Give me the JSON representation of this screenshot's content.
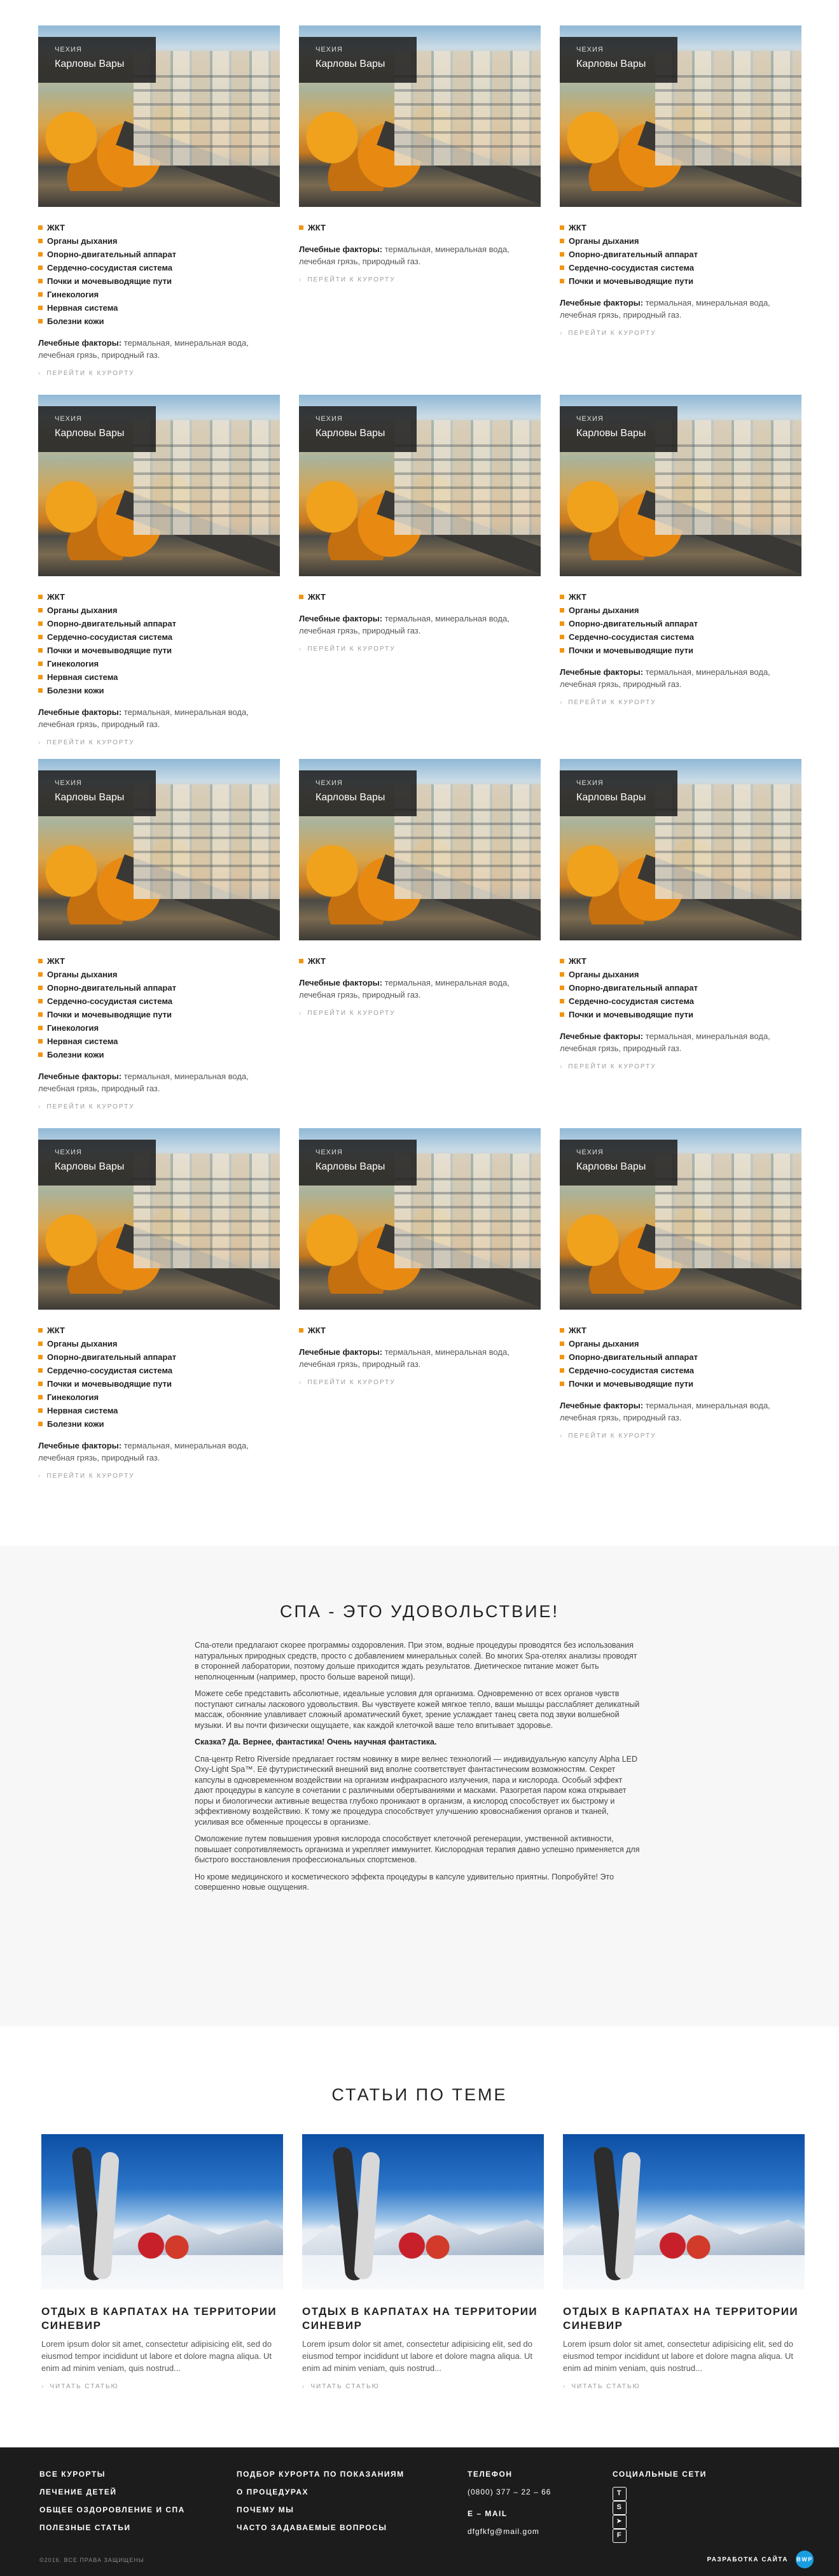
{
  "resort": {
    "country": "ЧЕХИЯ",
    "city": "Карловы Вары",
    "factors_label": "Лечебные факторы:",
    "factors_text": " термальная, минеральная вода, лечебная грязь, природный газ.",
    "go_label": "ПЕРЕЙТИ К КУРОРТУ"
  },
  "list_full": [
    "ЖКТ",
    "Органы дыхания",
    "Опорно-двигательный аппарат",
    "Сердечно-сосудистая система",
    "Почки и мочевыводящие пути",
    "Гинекология",
    "Нервная система",
    "Болезни кожи"
  ],
  "list_one": [
    "ЖКТ"
  ],
  "list_five": [
    "ЖКТ",
    "Органы дыхания",
    "Опорно-двигательный аппарат",
    "Сердечно-сосудистая система",
    "Почки и мочевыводящие пути"
  ],
  "spa": {
    "title": "СПА - ЭТО УДОВОЛЬСТВИЕ!",
    "p1": "Спа-отели предлагают скорее программы оздоровления. При этом, водные процедуры проводятся без использования натуральных природных средств, просто с добавлением минеральных солей. Во многих Spa-отелях анализы проводят в сторонней лаборатории, поэтому дольше приходится ждать результатов. Диетическое питание может быть неполноценным (например, просто больше вареной пищи).",
    "p2": "Можете себе представить абсолютные, идеальные условия для организма. Одновременно от всех органов чувств поступают сигналы ласкового удовольствия. Вы чувствуете кожей мягкое тепло, ваши мышцы расслабляет деликатный массаж, обоняние улавливает сложный ароматический букет, зрение услаждает танец света под звуки волшебной музыки. И вы почти физически ощущаете, как каждой клеточкой ваше тело впитывает здоровье.",
    "p3": "Сказка? Да. Вернее, фантастика! Очень научная фантастика.",
    "p4": "Спа-центр Retro Riverside предлагает гостям новинку в мире велнес технологий — индивидуальную капсулу Alpha LED Oxy-Light Spa™. Её футуристический внешний вид вполне соответствует фантастическим возможностям. Секрет капсулы в одновременном воздействии на организм инфракрасного излучения, пара и кислорода. Особый эффект дают процедуры в капсуле в сочетании с различными обертываниями и масками. Разогретая паром кожа открывает поры и биологически активные вещества глубоко проникают в организм, а кислород способствует их быстрому и эффективному воздействию. К тому же процедура способствует улучшению кровоснабжения органов и тканей, усиливая все обменные процессы в организме.",
    "p5": "Омоложение путем повышения уровня кислорода способствует клеточной регенерации, умственной активности, повышает сопротивляемость организма и укрепляет иммунитет. Кислородная терапия давно успешно применяется для быстрого восстановления профессиональных спортсменов.",
    "p6": "Но кроме медицинского и косметического эффекта процедуры в капсуле удивительно приятны. Попробуйте! Это совершенно новые ощущения."
  },
  "articles": {
    "title": "СТАТЬИ ПО ТЕМЕ",
    "item_title": "ОТДЫХ В КАРПАТАХ НА ТЕРРИТОРИИ СИНЕВИР",
    "item_text": "Lorem ipsum dolor sit amet, consectetur adipisicing elit, sed do eiusmod tempor incididunt ut labore et dolore magna aliqua. Ut enim ad minim veniam, quis nostrud...",
    "read_label": "ЧИТАТЬ СТАТЬЮ"
  },
  "footer": {
    "col1": [
      "ВСЕ КУРОРТЫ",
      "ЛЕЧЕНИЕ ДЕТЕЙ",
      "ОБЩЕЕ ОЗДОРОВЛЕНИЕ И СПА",
      "ПОЛЕЗНЫЕ СТАТЬИ"
    ],
    "col2": [
      "ПОДБОР КУРОРТА ПО ПОКАЗАНИЯМ",
      "О ПРОЦЕДУРАХ",
      "ПОЧЕМУ МЫ",
      "ЧАСТО ЗАДАВАЕМЫЕ ВОПРОСЫ"
    ],
    "phone_label": "ТЕЛЕФОН",
    "phone": "(0800) 377 – 22 – 66",
    "email_label": "E – MAIL",
    "email": "dfgfkfg@mail.gom",
    "social_label": "СОЦИАЛЬНЫЕ СЕТИ",
    "social_icons": [
      "twitter-icon",
      "skype-icon",
      "telegram-icon",
      "facebook-icon"
    ],
    "copyright": "©2016. ВСЕ ПРАВА ЗАЩИЩЕНЫ",
    "dev_label": "РАЗРАБОТКА САЙТА",
    "dev_logo": "BWP"
  }
}
